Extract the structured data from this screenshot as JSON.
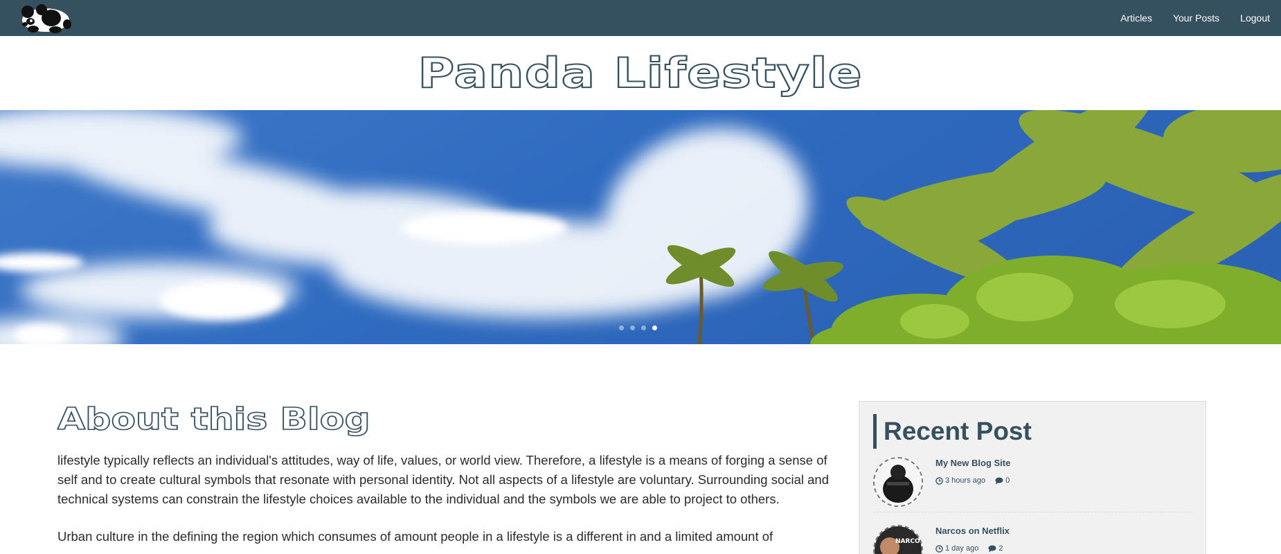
{
  "nav": {
    "links": [
      "Articles",
      "Your Posts",
      "Logout"
    ]
  },
  "site": {
    "title": "Panda Lifestyle"
  },
  "hero": {
    "slide_count": 4,
    "active_slide": 4
  },
  "about": {
    "title": "About this Blog",
    "paragraphs": [
      "lifestyle typically reflects an individual's attitudes, way of life, values, or world view. Therefore, a lifestyle is a means of forging a sense of self and to create cultural symbols that resonate with personal identity. Not all aspects of a lifestyle are voluntary. Surrounding social and technical systems can constrain the lifestyle choices available to the individual and the symbols we are able to project to others.",
      "Urban culture in the defining the region which consumes of amount people in a lifestyle is a different in and a limited amount of"
    ]
  },
  "sidebar": {
    "heading": "Recent Post",
    "posts": [
      {
        "title": "My New Blog Site",
        "time": "3 hours ago",
        "comments": "0"
      },
      {
        "title": "Narcos on Netflix",
        "time": "1 day ago",
        "comments": "2",
        "thumb_text": "NARCOS"
      }
    ]
  },
  "colors": {
    "nav_bg": "#35505f",
    "accent": "#35505f",
    "sidebar_bg": "#f1f1f1"
  },
  "icons": [
    "panda-logo-icon",
    "clock-icon",
    "comment-icon"
  ]
}
